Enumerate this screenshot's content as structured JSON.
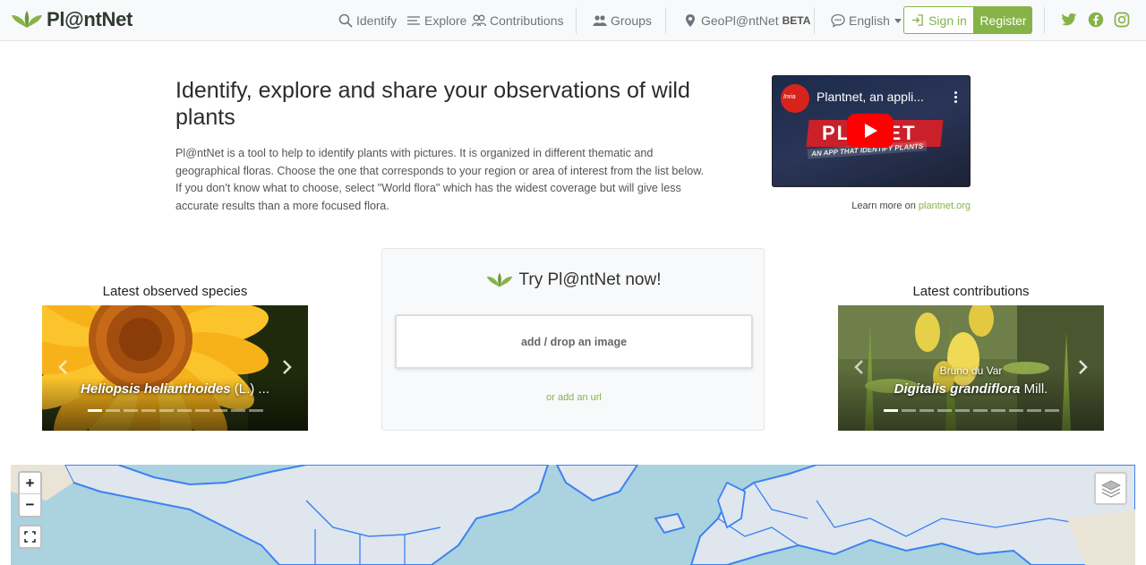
{
  "brand": {
    "name": "Pl@ntNet",
    "color": "#86b348"
  },
  "nav": {
    "identify": "Identify",
    "explore": "Explore",
    "contributions": "Contributions",
    "groups": "Groups",
    "geoplantnet": "GeoPl@ntNet",
    "beta": "BETA",
    "language": "English",
    "sign_in": "Sign in",
    "register": "Register"
  },
  "social": [
    "twitter-icon",
    "facebook-icon",
    "instagram-icon"
  ],
  "intro": {
    "title": "Identify, explore and share your observations of wild plants",
    "text": "Pl@ntNet is a tool to help to identify plants with pictures. It is organized in different thematic and geographical floras. Choose the one that corresponds to your region or area of interest from the list below. If you don't know what to choose, select \"World flora\" which has the widest coverage but will give less accurate results than a more focused flora."
  },
  "video": {
    "title": "Plantnet, an appli...",
    "channel": "Inria",
    "banner": "PL@NET",
    "tagline": "AN APP THAT IDENTIFY PLANTS",
    "learn_more_prefix": "Learn more on",
    "learn_more_link": "plantnet.org"
  },
  "latest_species": {
    "title": "Latest observed species",
    "caption_name": "Heliopsis helianthoides",
    "caption_author": " (L.) ...",
    "slides": 10,
    "active_slide": 0
  },
  "try_now": {
    "title": "Try Pl@ntNet now!",
    "drop_label": "add / drop an image",
    "url_label": "or add an url"
  },
  "latest_contributions": {
    "title": "Latest contributions",
    "author": "Bruno du Var",
    "caption_name": "Digitalis grandiflora",
    "caption_author": " Mill.",
    "slides": 10,
    "active_slide": 0
  },
  "map": {
    "zoom_in": "+",
    "zoom_out": "−"
  }
}
